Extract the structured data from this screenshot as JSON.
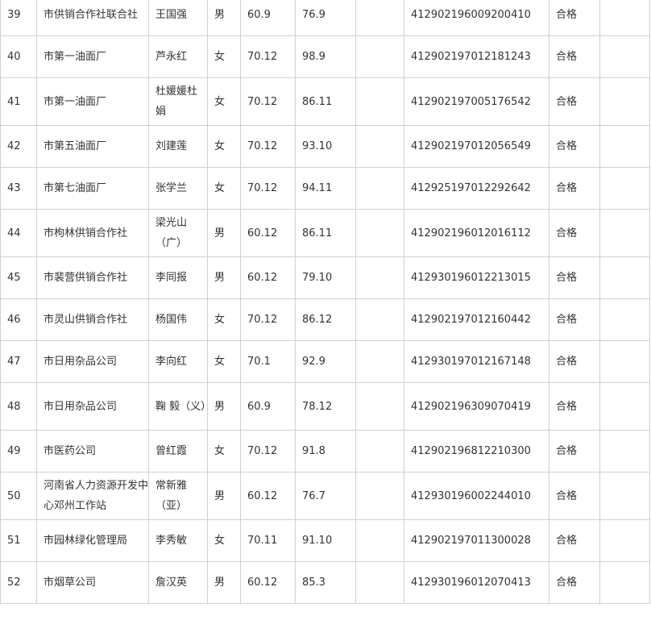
{
  "rows": [
    {
      "no": "39",
      "unit": "市供销合作社联合社",
      "name": "王国强",
      "gender": "男",
      "a": "60.9",
      "b": "76.9",
      "c": "",
      "id": "412902196009200410",
      "result": "合格",
      "note": ""
    },
    {
      "no": "40",
      "unit": "市第一油面厂",
      "name": "芦永红",
      "gender": "女",
      "a": "70.12",
      "b": "98.9",
      "c": "",
      "id": "412902197012181243",
      "result": "合格",
      "note": ""
    },
    {
      "no": "41",
      "unit": "市第一油面厂",
      "name": "杜媛媛杜娟",
      "gender": "女",
      "a": "70.12",
      "b": "86.11",
      "c": "",
      "id": "412902197005176542",
      "result": "合格",
      "note": ""
    },
    {
      "no": "42",
      "unit": "市第五油面厂",
      "name": "刘建莲",
      "gender": "女",
      "a": "70.12",
      "b": "93.10",
      "c": "",
      "id": "412902197012056549",
      "result": "合格",
      "note": ""
    },
    {
      "no": "43",
      "unit": "市第七油面厂",
      "name": "张学兰",
      "gender": "女",
      "a": "70.12",
      "b": "94.11",
      "c": "",
      "id": "412925197012292642",
      "result": "合格",
      "note": ""
    },
    {
      "no": "44",
      "unit": "市枸林供销合作社",
      "name": "梁光山（广）",
      "gender": "男",
      "a": "60.12",
      "b": "86.11",
      "c": "",
      "id": "412902196012016112",
      "result": "合格",
      "note": ""
    },
    {
      "no": "45",
      "unit": "市裴营供销合作社",
      "name": "李同报",
      "gender": "男",
      "a": "60.12",
      "b": "79.10",
      "c": "",
      "id": "412930196012213015",
      "result": "合格",
      "note": ""
    },
    {
      "no": "46",
      "unit": "市灵山供销合作社",
      "name": "杨国伟",
      "gender": "女",
      "a": "70.12",
      "b": "86.12",
      "c": "",
      "id": "412902197012160442",
      "result": "合格",
      "note": ""
    },
    {
      "no": "47",
      "unit": "市日用杂品公司",
      "name": "李向红",
      "gender": "女",
      "a": "70.1",
      "b": "92.9",
      "c": "",
      "id": "412930197012167148",
      "result": "合格",
      "note": ""
    },
    {
      "no": "48",
      "unit": "市日用杂品公司",
      "name": "鞠 毅（义）",
      "gender": "男",
      "a": "60.9",
      "b": "78.12",
      "c": "",
      "id": "412902196309070419",
      "result": "合格",
      "note": ""
    },
    {
      "no": "49",
      "unit": "市医药公司",
      "name": "曾红霞",
      "gender": "女",
      "a": "70.12",
      "b": "91.8",
      "c": "",
      "id": "412902196812210300",
      "result": "合格",
      "note": ""
    },
    {
      "no": "50",
      "unit": "河南省人力资源开发中心邓州工作站",
      "name": "常新雅（亚）",
      "gender": "男",
      "a": "60.12",
      "b": "76.7",
      "c": "",
      "id": "412930196002244010",
      "result": "合格",
      "note": ""
    },
    {
      "no": "51",
      "unit": "市园林绿化管理局",
      "name": "李秀敏",
      "gender": "女",
      "a": "70.11",
      "b": "91.10",
      "c": "",
      "id": "412902197011300028",
      "result": "合格",
      "note": ""
    },
    {
      "no": "52",
      "unit": "市烟草公司",
      "name": "詹汉英",
      "gender": "男",
      "a": "60.12",
      "b": "85.3",
      "c": "",
      "id": "412930196012070413",
      "result": "合格",
      "note": ""
    }
  ]
}
